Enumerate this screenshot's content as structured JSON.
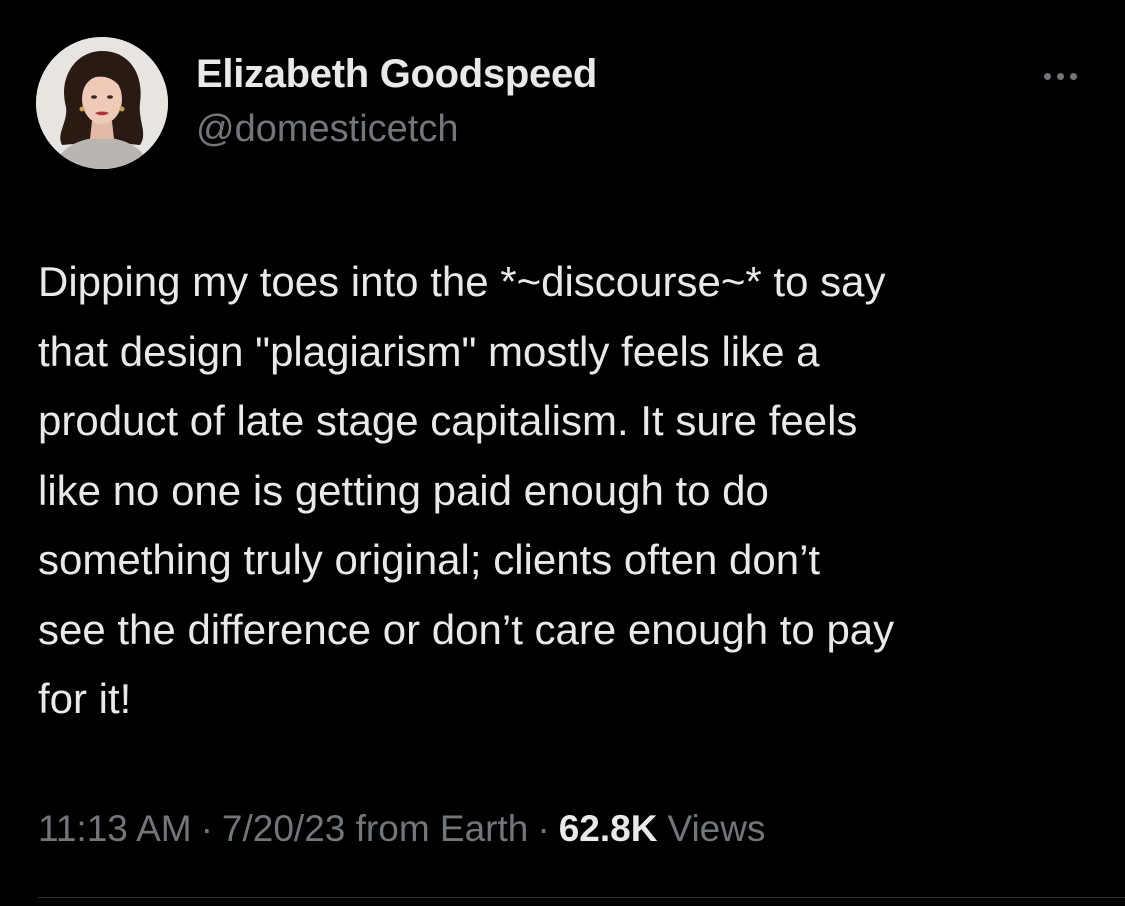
{
  "user": {
    "display_name": "Elizabeth Goodspeed",
    "handle": "@domesticetch",
    "avatar_icon": "profile-photo"
  },
  "more_icon": "ellipsis-icon",
  "tweet": {
    "text": "Dipping my toes into the *~discourse~* to say\nthat design \"plagiarism\" mostly feels like a\nproduct of late stage capitalism. It sure feels\nlike no one is getting paid enough to do\nsomething truly original; clients often don’t\nsee the difference or don’t care enough to pay\nfor it!"
  },
  "meta": {
    "time": "11:13 AM",
    "separator": "·",
    "date_source": "7/20/23 from Earth",
    "views_count": "62.8K",
    "views_label": "Views"
  },
  "colors": {
    "background": "#000000",
    "primary_text": "#e7e9ea",
    "secondary_text": "#71767b",
    "divider": "#2f3336"
  }
}
